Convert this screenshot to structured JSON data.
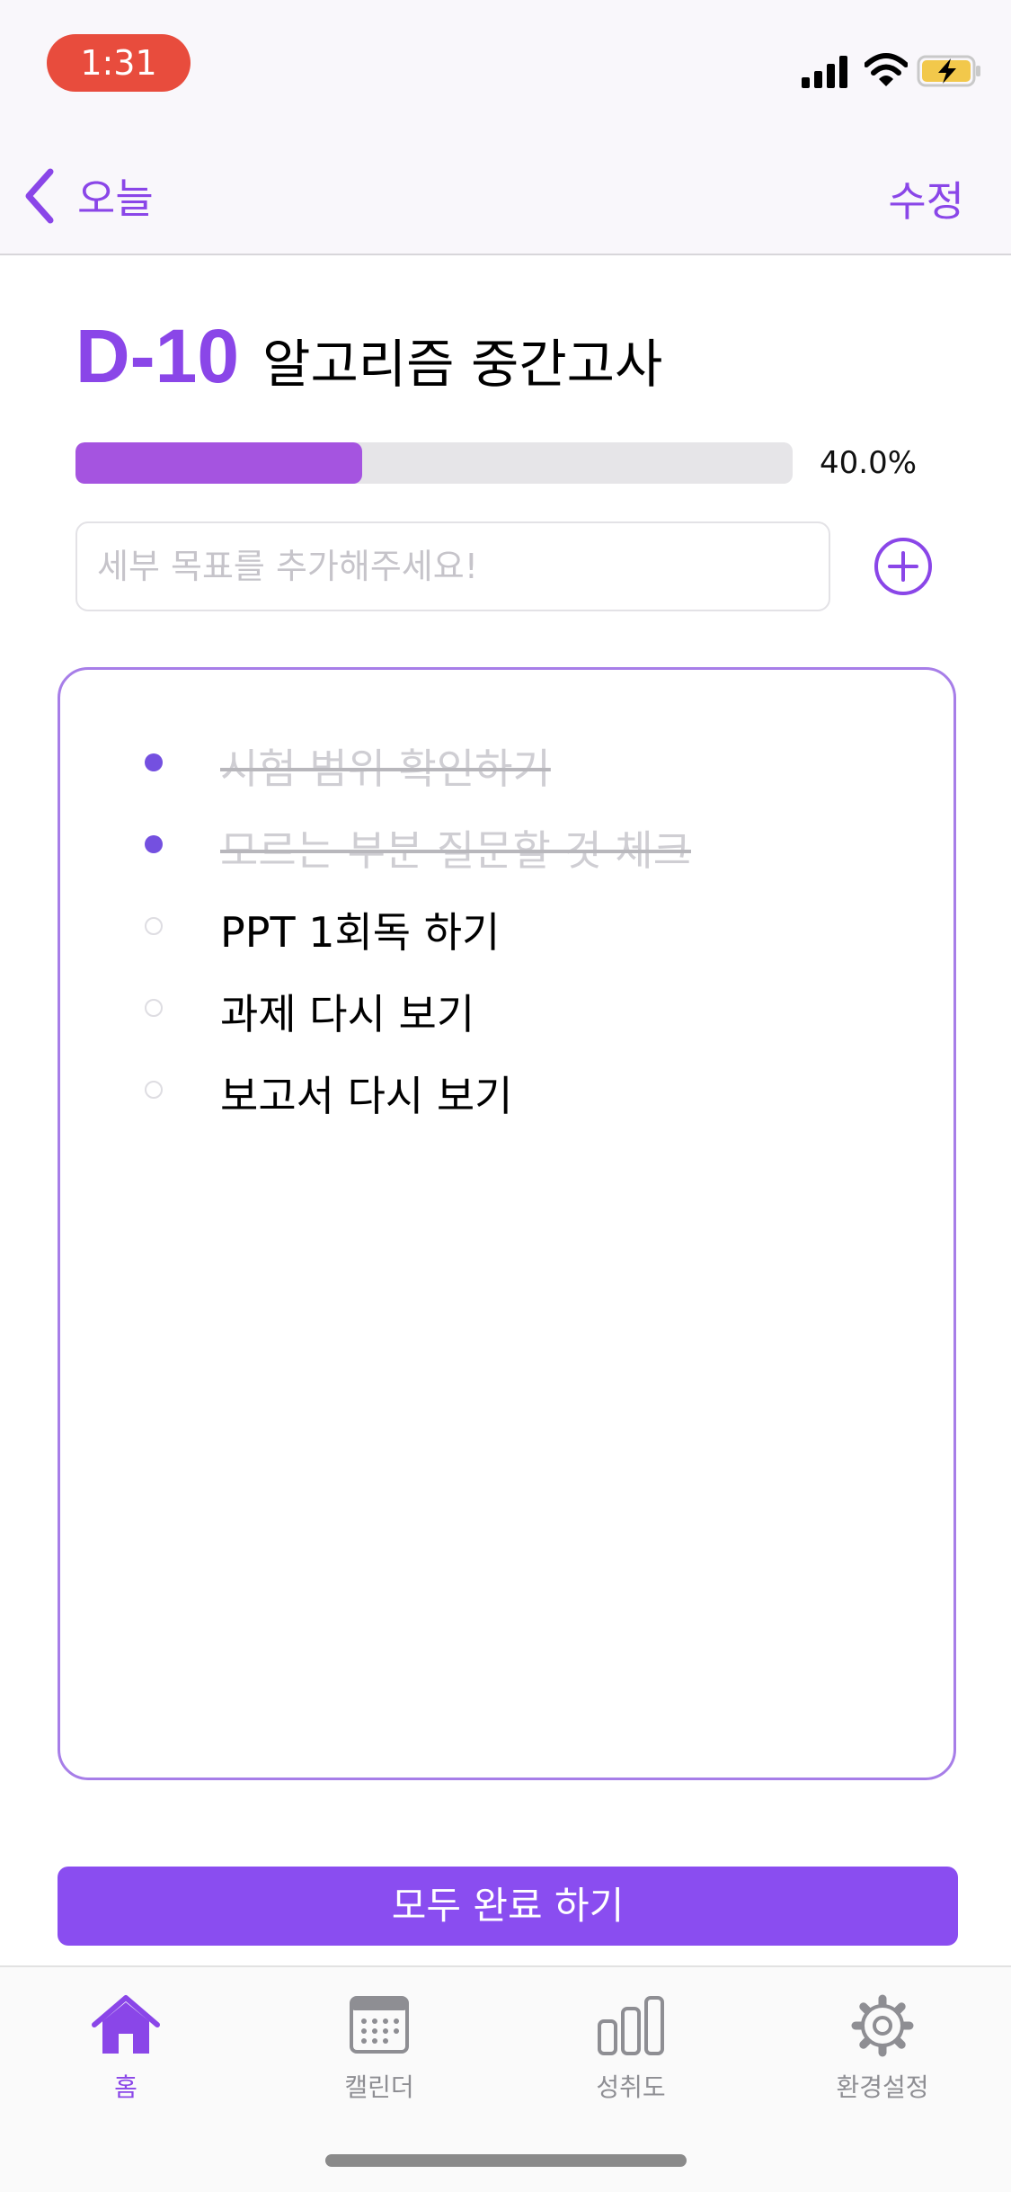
{
  "status_bar": {
    "time": "1:31",
    "time_color": "#e84c3d"
  },
  "nav": {
    "back_label": "오늘",
    "edit_label": "수정",
    "accent": "#8a46e8"
  },
  "goal": {
    "dday": "D-10",
    "title": "알고리즘 중간고사"
  },
  "progress": {
    "value": 0.4,
    "text": "40.0%"
  },
  "subgoal_input": {
    "placeholder": "세부 목표를 추가해주세요!",
    "value": ""
  },
  "tasks": [
    {
      "label": "시험 범위 확인하기",
      "done": true
    },
    {
      "label": "모르는 부분 질문할 것 체크",
      "done": true
    },
    {
      "label": "PPT 1회독 하기",
      "done": false
    },
    {
      "label": "과제 다시 보기",
      "done": false
    },
    {
      "label": "보고서 다시 보기",
      "done": false
    }
  ],
  "complete_all_label": "모두 완료 하기",
  "tabbar": {
    "active": "home",
    "items": [
      {
        "id": "home",
        "label": "홈",
        "icon": "home-icon"
      },
      {
        "id": "calendar",
        "label": "캘린더",
        "icon": "calendar-icon"
      },
      {
        "id": "achievement",
        "label": "성취도",
        "icon": "bar-chart-icon"
      },
      {
        "id": "settings",
        "label": "환경설정",
        "icon": "gear-icon"
      }
    ]
  }
}
